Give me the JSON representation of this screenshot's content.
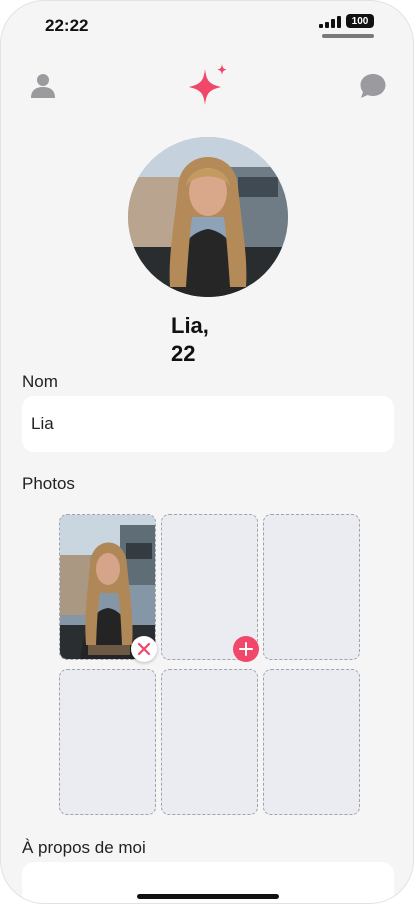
{
  "status_bar": {
    "time": "22:22",
    "battery": "100"
  },
  "nav": {
    "left_icon": "user-icon",
    "center_icon": "sparkle-logo-icon",
    "right_icon": "chat-bubble-icon",
    "accent_color": "#f0476a"
  },
  "profile": {
    "name": "Lia,",
    "age": "22"
  },
  "form": {
    "name_label": "Nom",
    "name_value": "Lia",
    "photos_label": "Photos",
    "about_label": "À propos de moi",
    "about_value": ""
  },
  "photos": {
    "filled_count": 1,
    "total_slots": 6,
    "remove_icon": "close-icon",
    "add_icon": "plus-icon"
  }
}
